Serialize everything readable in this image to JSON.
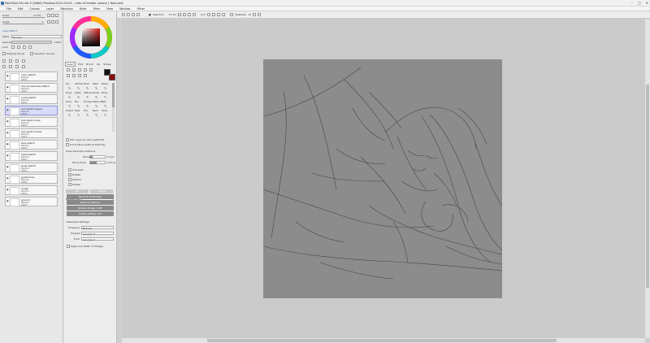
{
  "window": {
    "title": "PaintTool SAI Ver.2 (64bit) Preview.2022.04.05 - redo of header cosmo / Tana.sai2",
    "controls": [
      "–",
      "□",
      "✕"
    ]
  },
  "menu": [
    "File",
    "Edit",
    "Canvas",
    "Layer",
    "Selection",
    "Ruler",
    "Filter",
    "View",
    "Window",
    "Other"
  ],
  "toolbar": {
    "selection_label": "Selection",
    "zoom": "17.5%",
    "angle": "0.0°",
    "stabilizer_label": "Stabilizer",
    "stabilizer_value": "10"
  },
  "left": {
    "scale_label": "Scale",
    "scale_value": "17.5%",
    "angle_label": "Angle",
    "angle_value": "0",
    "layer_effect": "Layer Effect",
    "mode_label": "Mode",
    "mode_value": "Normal",
    "opacity_label": "Opacity",
    "opacity_value": "100%",
    "lock_label": "Lock",
    "clipping_label": "Clipping Group",
    "selection_source_label": "Selection Source",
    "layers": [
      {
        "name": "color sketch",
        "mode": "Normal",
        "opacity": "100%",
        "selected": false
      },
      {
        "name": "hair accessories sketch",
        "mode": "Normal",
        "opacity": "100%",
        "selected": false
      },
      {
        "name": "nude sketch",
        "mode": "Normal",
        "opacity": "100%",
        "selected": false
      },
      {
        "name": "hair sketch upper",
        "mode": "Normal",
        "opacity": "100%",
        "selected": true
      },
      {
        "name": "hair sketch new",
        "mode": "Normal",
        "opacity": "100%",
        "selected": false
      },
      {
        "name": "hair sketch lower",
        "mode": "Normal",
        "opacity": "100%",
        "selected": false
      },
      {
        "name": "face sketch",
        "mode": "Normal",
        "opacity": "100%",
        "selected": false
      },
      {
        "name": "head sketch",
        "mode": "Normal",
        "opacity": "100%",
        "selected": false
      },
      {
        "name": "body sketch",
        "mode": "Normal",
        "opacity": "100%",
        "selected": false
      },
      {
        "name": "guide lines",
        "mode": "Normal",
        "opacity": "100%",
        "selected": false
      },
      {
        "name": "rough",
        "mode": "Normal",
        "opacity": "100%",
        "selected": false
      },
      {
        "name": "ground",
        "mode": "Normal",
        "opacity": "100%",
        "selected": false
      }
    ]
  },
  "tools": {
    "tabs": [
      "Select",
      "Edit",
      "Brush",
      "Ink",
      "Shape"
    ],
    "primary_color": "#111111",
    "secondary_color": "#8b0d0d",
    "brushes": [
      "Pen",
      "AirBrush",
      "Brush",
      "Water",
      "Marker",
      "Eraser",
      "SelPen",
      "SelErase",
      "Bucket",
      "Binary",
      "Pencil",
      "Blur",
      "Smudge",
      "Watercolor",
      "Fade",
      "Eraser2",
      "Mask",
      "Tone",
      "Blend",
      "Shade"
    ],
    "pick_layer": "Pick Layer by Ctrl+Left/Shift",
    "cut_move": "Cut & Move without Shift Key",
    "snap_label": "Snap Selection Distance",
    "move_label": "Move",
    "move_value": "1.0 px",
    "rot_label": "Rot & Move",
    "rot_value": "2.50 px",
    "checks": [
      "Translate",
      "Rotate",
      "Deform",
      "Rotate"
    ],
    "ok_label": "OK",
    "cancel_label": "Cancel",
    "perspective_label": "Perspective",
    "actions": [
      "Reverse Horizontal",
      "Reverse Vertical",
      "Rotate 90deg. CCW",
      "Rotate 90deg. CW"
    ],
    "resample_label": "Resample Settings",
    "dragging_label": "Dragging",
    "dragging_value": "Bilinear",
    "preview_label": "Preview",
    "preview_value": "Lanczos 3",
    "final_label": "Final",
    "final_value": "Lanczos 3",
    "keep_line_label": "Keep Line Width of Shapes"
  }
}
